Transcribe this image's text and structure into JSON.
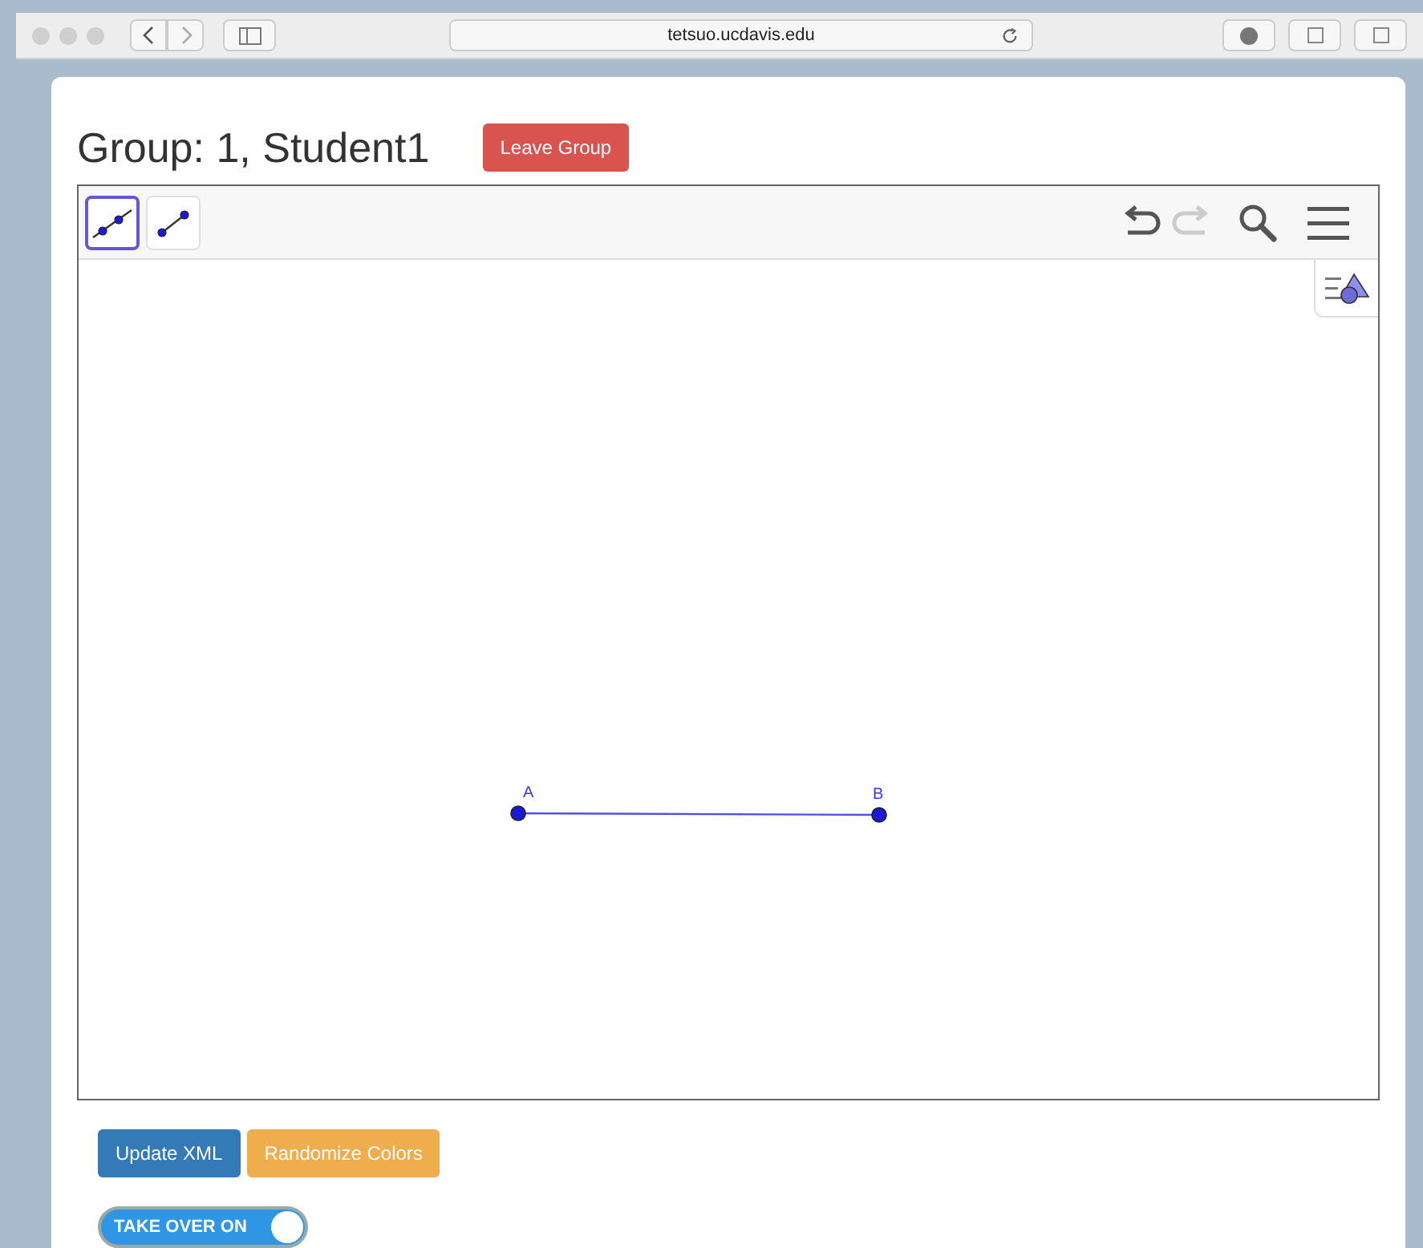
{
  "browser": {
    "url": "tetsuo.ucdavis.edu"
  },
  "header": {
    "title": "Group: 1, Student1",
    "leave_button": "Leave Group"
  },
  "applet": {
    "tools": [
      {
        "kind": "line",
        "selected": true
      },
      {
        "kind": "segment",
        "selected": false
      }
    ],
    "redo_disabled": true,
    "points": [
      {
        "label": "A"
      },
      {
        "label": "B"
      }
    ]
  },
  "buttons": [
    {
      "label": "Update XML",
      "kind": "primary"
    },
    {
      "label": "Randomize Colors",
      "kind": "warning"
    }
  ],
  "toggle": {
    "label": "TAKE OVER ON",
    "on": true
  }
}
